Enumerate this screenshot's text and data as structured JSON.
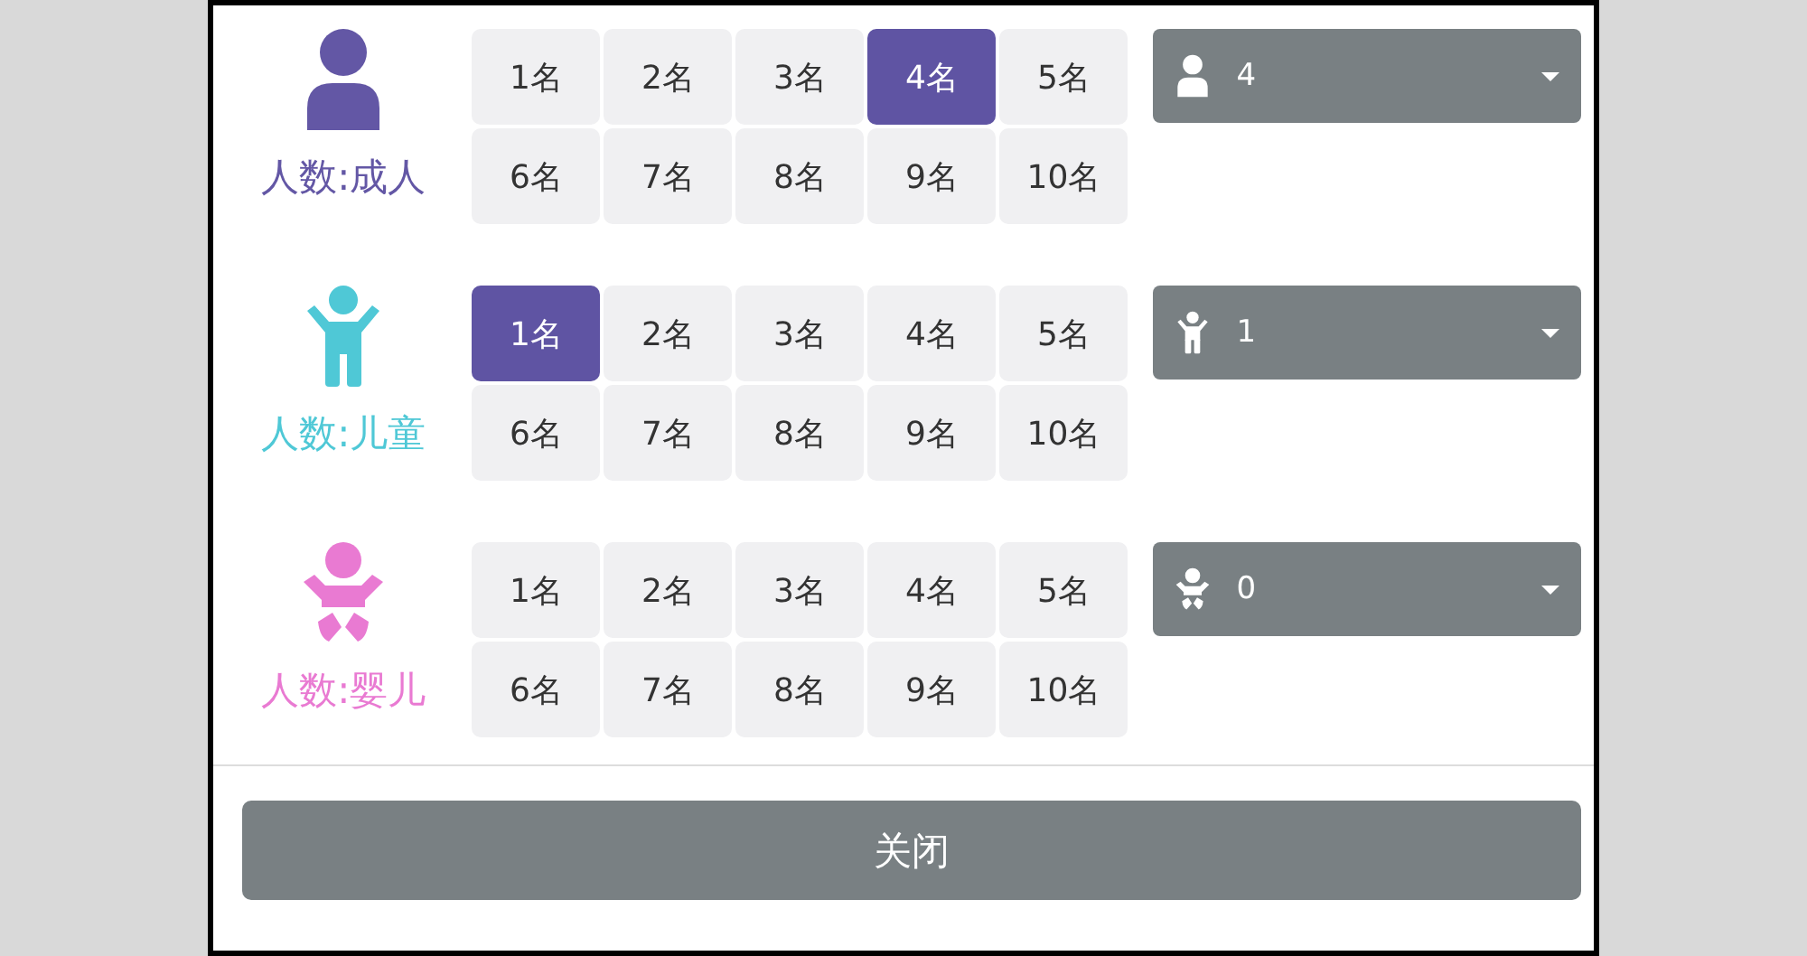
{
  "groups": [
    {
      "kind": "adult",
      "label": "人数:成人",
      "color": "#6357a5",
      "options": [
        {
          "label": "1名",
          "selected": false
        },
        {
          "label": "2名",
          "selected": false
        },
        {
          "label": "3名",
          "selected": false
        },
        {
          "label": "4名",
          "selected": true
        },
        {
          "label": "5名",
          "selected": false
        },
        {
          "label": "6名",
          "selected": false
        },
        {
          "label": "7名",
          "selected": false
        },
        {
          "label": "8名",
          "selected": false
        },
        {
          "label": "9名",
          "selected": false
        },
        {
          "label": "10名",
          "selected": false
        }
      ],
      "select_value": "4"
    },
    {
      "kind": "child",
      "label": "人数:儿童",
      "color": "#4fc8d6",
      "options": [
        {
          "label": "1名",
          "selected": true
        },
        {
          "label": "2名",
          "selected": false
        },
        {
          "label": "3名",
          "selected": false
        },
        {
          "label": "4名",
          "selected": false
        },
        {
          "label": "5名",
          "selected": false
        },
        {
          "label": "6名",
          "selected": false
        },
        {
          "label": "7名",
          "selected": false
        },
        {
          "label": "8名",
          "selected": false
        },
        {
          "label": "9名",
          "selected": false
        },
        {
          "label": "10名",
          "selected": false
        }
      ],
      "select_value": "1"
    },
    {
      "kind": "infant",
      "label": "人数:婴儿",
      "color": "#e97ad2",
      "options": [
        {
          "label": "1名",
          "selected": false
        },
        {
          "label": "2名",
          "selected": false
        },
        {
          "label": "3名",
          "selected": false
        },
        {
          "label": "4名",
          "selected": false
        },
        {
          "label": "5名",
          "selected": false
        },
        {
          "label": "6名",
          "selected": false
        },
        {
          "label": "7名",
          "selected": false
        },
        {
          "label": "8名",
          "selected": false
        },
        {
          "label": "9名",
          "selected": false
        },
        {
          "label": "10名",
          "selected": false
        }
      ],
      "select_value": "0"
    }
  ],
  "close_button": "关闭"
}
